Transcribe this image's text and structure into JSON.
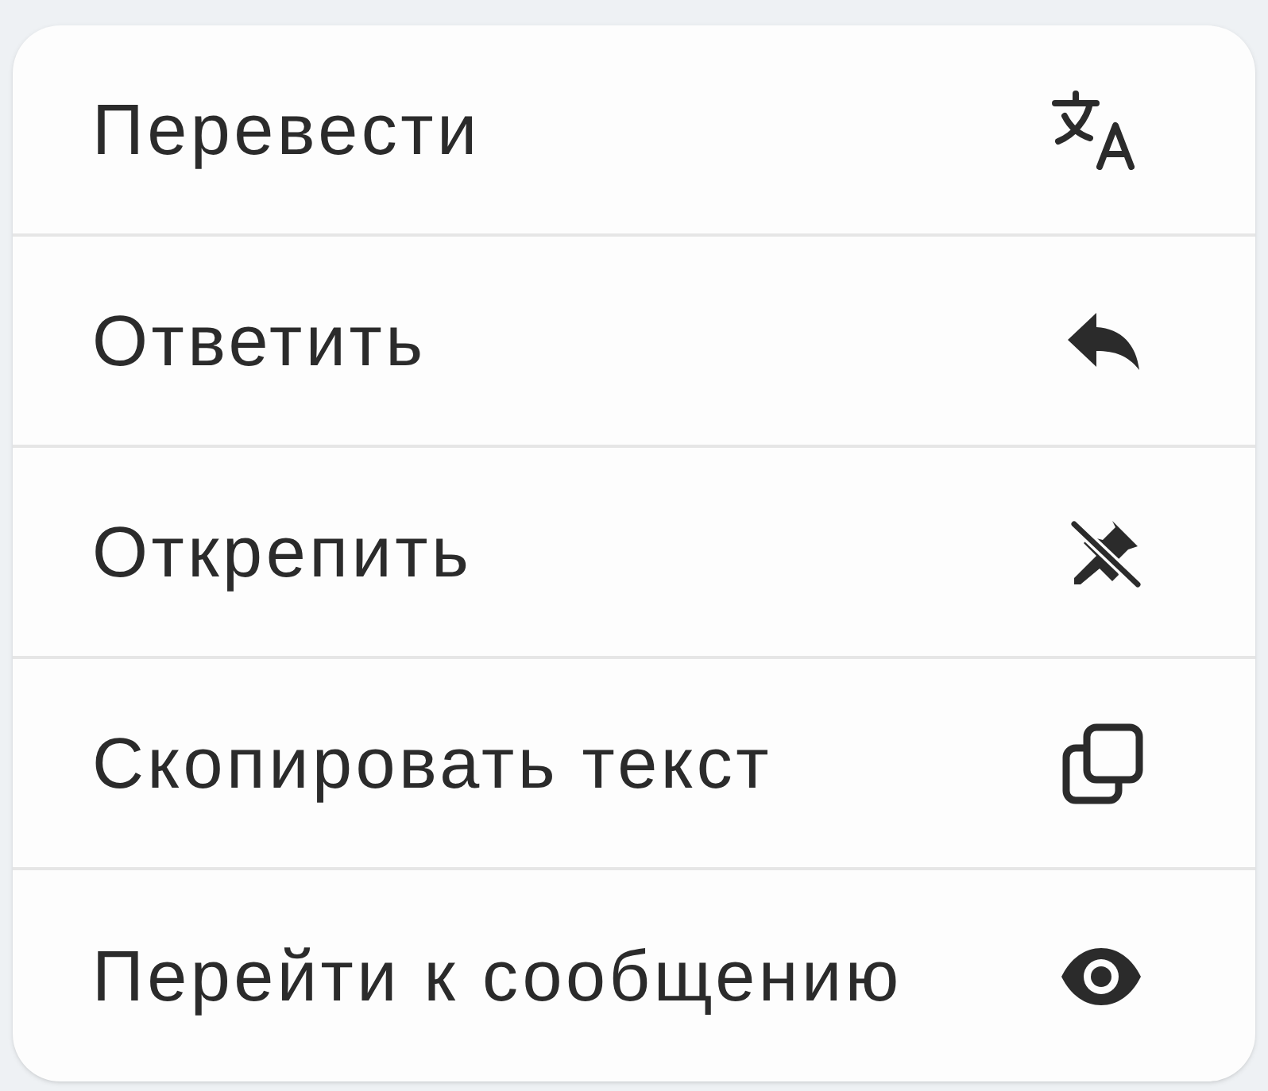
{
  "menu": {
    "items": [
      {
        "label": "Перевести",
        "kind": "translate"
      },
      {
        "label": "Ответить",
        "kind": "reply"
      },
      {
        "label": "Открепить",
        "kind": "unpin"
      },
      {
        "label": "Скопировать текст",
        "kind": "copy"
      },
      {
        "label": "Перейти к сообщению",
        "kind": "view"
      }
    ]
  }
}
